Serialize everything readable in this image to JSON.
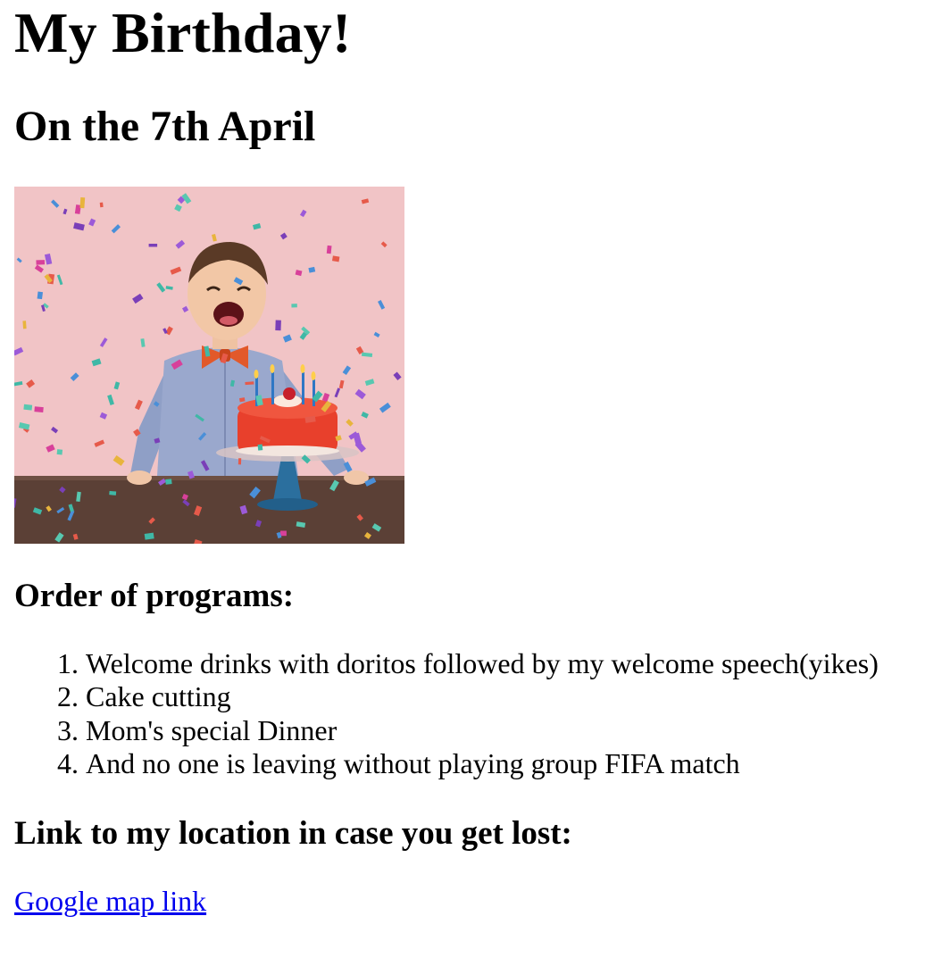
{
  "header": {
    "title": "My Birthday!",
    "subtitle": "On the 7th April"
  },
  "image": {
    "icon": "birthday-photo-boy-cake-confetti",
    "colors": {
      "background_pink": "#f1c4c6",
      "table_wood": "#5b4036",
      "cake_red": "#e8402c",
      "shirt_blue": "#8f9fc6",
      "bowtie_orange": "#e2592a"
    }
  },
  "programs": {
    "heading": "Order of programs:",
    "items": [
      "Welcome drinks with doritos followed by my welcome speech(yikes)",
      "Cake cutting",
      "Mom's special Dinner",
      "And no one is leaving without playing group FIFA match"
    ]
  },
  "location": {
    "heading": "Link to my location in case you get lost:",
    "link_label": "Google map link",
    "link_color": "#0000ee"
  }
}
